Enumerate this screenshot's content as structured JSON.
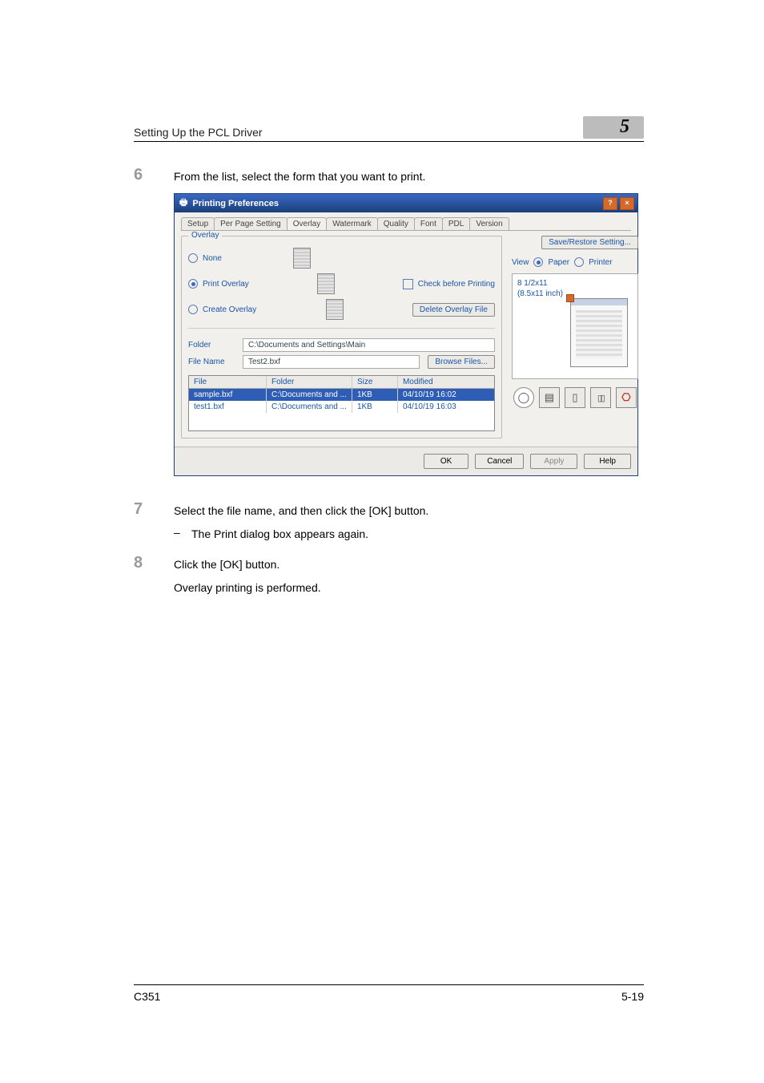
{
  "header": {
    "section_title": "Setting Up the PCL Driver",
    "chapter_number": "5"
  },
  "steps": [
    {
      "num": "6",
      "text": "From the list, select the form that you want to print."
    },
    {
      "num": "7",
      "text": "Select the file name, and then click the [OK] button.",
      "sub": [
        "The Print dialog box appears again."
      ]
    },
    {
      "num": "8",
      "text": "Click the [OK] button.",
      "sub_plain": [
        "Overlay printing is performed."
      ]
    }
  ],
  "dialog": {
    "title": "Printing Preferences",
    "tabs": [
      "Setup",
      "Per Page Setting",
      "Overlay",
      "Watermark",
      "Quality",
      "Font",
      "PDL",
      "Version"
    ],
    "active_tab_index": 2,
    "overlay_group": "Overlay",
    "radios": {
      "none": "None",
      "print": "Print Overlay",
      "create": "Create Overlay"
    },
    "check_before": "Check before Printing",
    "delete_btn": "Delete Overlay File",
    "folder_label": "Folder",
    "folder_value": "C:\\Documents and Settings\\Main",
    "filename_label": "File Name",
    "filename_value": "Test2.bxf",
    "browse_btn": "Browse Files...",
    "list": {
      "cols": [
        "File",
        "Folder",
        "Size",
        "Modified"
      ],
      "rows": [
        {
          "file": "sample.bxf",
          "folder": "C:\\Documents and ...",
          "size": "1KB",
          "modified": "04/10/19 16:02",
          "selected": true
        },
        {
          "file": "test1.bxf",
          "folder": "C:\\Documents and ...",
          "size": "1KB",
          "modified": "04/10/19 16:03",
          "selected": false
        }
      ]
    },
    "save_restore": "Save/Restore Setting...",
    "view_label": "View",
    "view_paper": "Paper",
    "view_printer": "Printer",
    "paper_info1": "8 1/2x11",
    "paper_info2": "(8.5x11 inch)",
    "buttons": {
      "ok": "OK",
      "cancel": "Cancel",
      "apply": "Apply",
      "help": "Help"
    }
  },
  "footer": {
    "model": "C351",
    "page": "5-19"
  }
}
